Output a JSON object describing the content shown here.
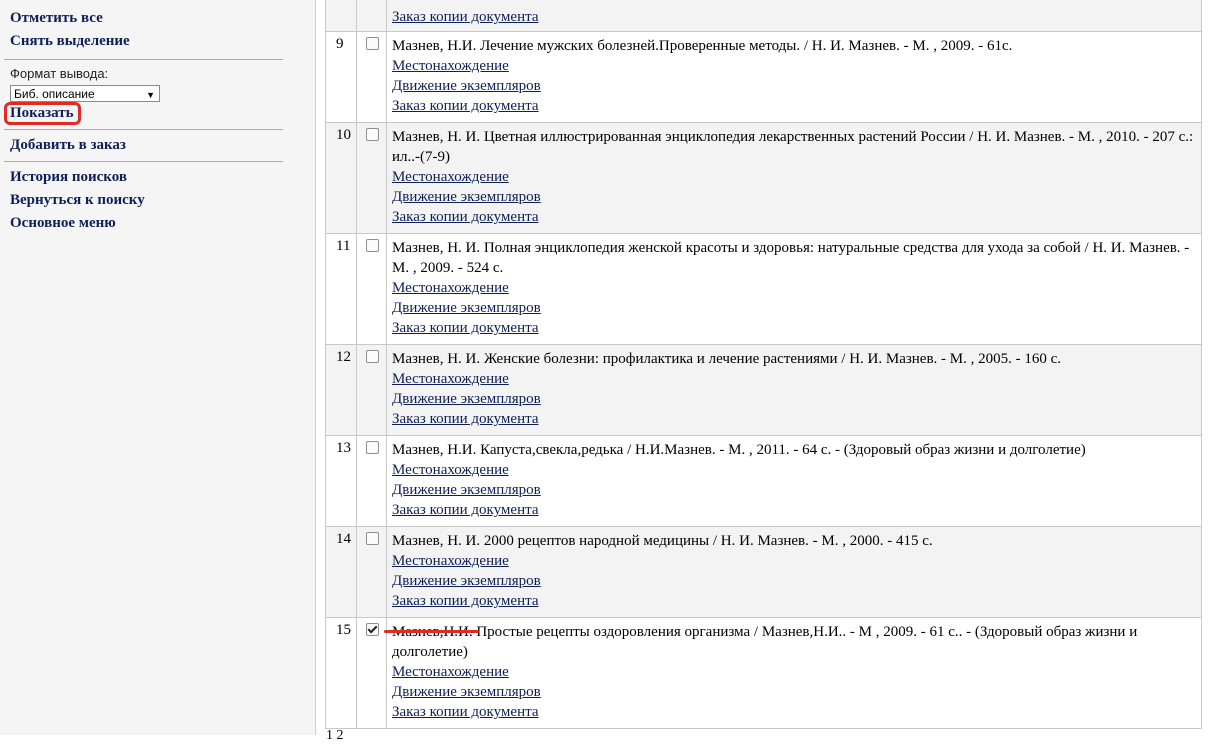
{
  "sidebar": {
    "select_all": "Отметить все",
    "deselect": "Снять выделение",
    "format_label": "Формат вывода:",
    "format_value": "Биб. описание",
    "show": "Показать",
    "add_to_order": "Добавить в заказ",
    "search_history": "История поисков",
    "back_to_search": "Вернуться к поиску",
    "main_menu": "Основное меню"
  },
  "links": {
    "location": "Местонахождение",
    "movement": "Движение экземпляров",
    "copy_order": "Заказ копии документа"
  },
  "rows": [
    {
      "num": "9",
      "desc": "Мазнев, Н.И. Лечение мужских болезней.Проверенные методы. / Н. И. Мазнев. - М. , 2009. - 61с."
    },
    {
      "num": "10",
      "desc": "Мазнев, Н. И. Цветная иллюстрированная энциклопедия лекарственных растений России / Н. И. Мазнев. - М. , 2010. - 207 с.: ил..-(7-9)"
    },
    {
      "num": "11",
      "desc": "Мазнев, Н. И. Полная энциклопедия женской красоты и здоровья: натуральные средства для ухода за собой / Н. И. Мазнев. - М. , 2009. - 524 с."
    },
    {
      "num": "12",
      "desc": "Мазнев, Н. И. Женские болезни: профилактика и лечение растениями / Н. И. Мазнев. - М. , 2005. - 160 с."
    },
    {
      "num": "13",
      "desc": "Мазнев, Н.И. Капуста,свекла,редька / Н.И.Мазнев. - М. , 2011. - 64 с. - (Здоровый образ жизни и долголетие)"
    },
    {
      "num": "14",
      "desc": "Мазнев, Н. И. 2000 рецептов народной медицины / Н. И. Мазнев. - М. , 2000. - 415 с."
    },
    {
      "num": "15",
      "desc": "Мазнев,Н.И. Простые рецепты оздоровления организма / Мазнев,Н.И.. - М , 2009. - 61 с.. - (Здоровый образ жизни и долголетие)"
    }
  ],
  "pager": "1 2",
  "colors": {
    "link": "#0f1f57",
    "highlight": "#e02b22"
  }
}
